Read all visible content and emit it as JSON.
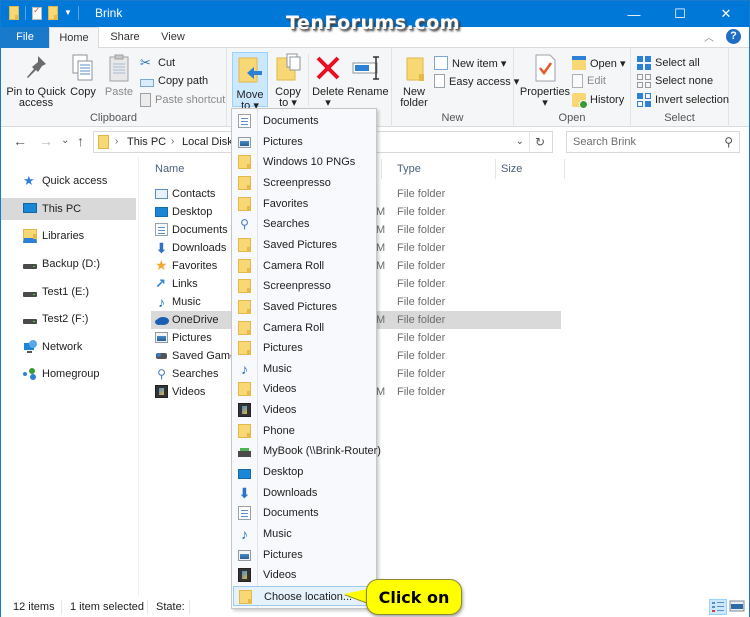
{
  "window": {
    "title": "Brink",
    "watermark": "TenForums.com",
    "controls": {
      "minimize": "—",
      "maximize": "☐",
      "close": "✕"
    }
  },
  "ribbon_tabs": [
    {
      "label": "File"
    },
    {
      "label": "Home"
    },
    {
      "label": "Share"
    },
    {
      "label": "View"
    }
  ],
  "ribbon": {
    "clipboard": {
      "label": "Clipboard",
      "pin": "Pin to Quick access",
      "pin_line1": "Pin to Quick",
      "pin_line2": "access",
      "copy": "Copy",
      "paste": "Paste",
      "cut": "Cut",
      "copy_path": "Copy path",
      "paste_shortcut": "Paste shortcut"
    },
    "organize": {
      "move_line1": "Move",
      "move_line2": "to ▾",
      "copy_line1": "Copy",
      "copy_line2": "to ▾",
      "delete": "Delete",
      "delete_arrow": "▾",
      "rename": "Rename"
    },
    "new": {
      "label": "New",
      "new_folder_line1": "New",
      "new_folder_line2": "folder",
      "new_item": "New item ▾",
      "easy_access": "Easy access ▾"
    },
    "open": {
      "label": "Open",
      "properties": "Properties",
      "properties_arrow": "▾",
      "open": "Open ▾",
      "edit": "Edit",
      "history": "History"
    },
    "select": {
      "label": "Select",
      "select_all": "Select all",
      "select_none": "Select none",
      "invert": "Invert selection"
    }
  },
  "navigation": {
    "back": "←",
    "forward": "→",
    "recent": "⌄",
    "up": "↑",
    "breadcrumb": [
      "This PC",
      "Local Disk (C:)"
    ],
    "breadcrumb_visible": [
      "This PC",
      "Local Disk ("
    ],
    "search_placeholder": "Search Brink"
  },
  "nav_pane": [
    {
      "label": "Quick access",
      "icon": "star-icon"
    },
    {
      "label": "This PC",
      "icon": "computer-icon",
      "selected": true
    },
    {
      "label": "Libraries",
      "icon": "libraries-icon"
    },
    {
      "label": "Backup (D:)",
      "icon": "drive-icon"
    },
    {
      "label": "Test1 (E:)",
      "icon": "drive-icon"
    },
    {
      "label": "Test2 (F:)",
      "icon": "drive-icon"
    },
    {
      "label": "Network",
      "icon": "network-icon"
    },
    {
      "label": "Homegroup",
      "icon": "homegroup-icon"
    }
  ],
  "columns": {
    "name": "Name",
    "type": "Type",
    "size": "Size"
  },
  "files": [
    {
      "name": "Contacts",
      "date_frag": "",
      "type": "File folder",
      "icon": "contacts-icon"
    },
    {
      "name": "Desktop",
      "date_frag": "M",
      "type": "File folder",
      "icon": "desktop-icon"
    },
    {
      "name": "Documents",
      "date_frag": "M",
      "type": "File folder",
      "icon": "documents-icon"
    },
    {
      "name": "Downloads",
      "date_frag": "M",
      "type": "File folder",
      "icon": "downloads-icon"
    },
    {
      "name": "Favorites",
      "date_frag": "M",
      "type": "File folder",
      "icon": "favorites-icon"
    },
    {
      "name": "Links",
      "date_frag": "",
      "type": "File folder",
      "icon": "links-icon"
    },
    {
      "name": "Music",
      "date_frag": "",
      "type": "File folder",
      "icon": "music-icon"
    },
    {
      "name": "OneDrive",
      "date_frag": "M",
      "type": "File folder",
      "icon": "onedrive-icon",
      "selected": true
    },
    {
      "name": "Pictures",
      "date_frag": "",
      "type": "File folder",
      "icon": "pictures-icon"
    },
    {
      "name": "Saved Games",
      "date_frag": "",
      "type": "File folder",
      "icon": "saved-games-icon"
    },
    {
      "name": "Searches",
      "date_frag": "",
      "type": "File folder",
      "icon": "searches-icon"
    },
    {
      "name": "Videos",
      "date_frag": "M",
      "type": "File folder",
      "icon": "videos-icon"
    }
  ],
  "move_menu": [
    {
      "label": "Documents",
      "icon": "doc"
    },
    {
      "label": "Pictures",
      "icon": "pic"
    },
    {
      "label": "Windows 10 PNGs",
      "icon": "folder"
    },
    {
      "label": "Screenpresso",
      "icon": "folder"
    },
    {
      "label": "Favorites",
      "icon": "folder"
    },
    {
      "label": "Searches",
      "icon": "search"
    },
    {
      "label": "Saved Pictures",
      "icon": "folder"
    },
    {
      "label": "Camera Roll",
      "icon": "folder"
    },
    {
      "label": "Screenpresso",
      "icon": "folder"
    },
    {
      "label": "Saved Pictures",
      "icon": "folder"
    },
    {
      "label": "Camera Roll",
      "icon": "folder"
    },
    {
      "label": "Pictures",
      "icon": "folder"
    },
    {
      "label": "Music",
      "icon": "music"
    },
    {
      "label": "Videos",
      "icon": "folder"
    },
    {
      "label": "Videos",
      "icon": "vid"
    },
    {
      "label": "Phone",
      "icon": "folder"
    },
    {
      "label": "MyBook (\\\\Brink-Router)",
      "icon": "netdrive"
    },
    {
      "label": "Desktop",
      "icon": "desktop"
    },
    {
      "label": "Downloads",
      "icon": "down"
    },
    {
      "label": "Documents",
      "icon": "doc"
    },
    {
      "label": "Music",
      "icon": "music"
    },
    {
      "label": "Pictures",
      "icon": "pic"
    },
    {
      "label": "Videos",
      "icon": "vid"
    },
    {
      "label": "Choose location...",
      "icon": "folder",
      "highlighted": true
    }
  ],
  "callout": {
    "text": "Click on"
  },
  "status": {
    "items": "12 items",
    "selected": "1 item selected",
    "state": "State:"
  }
}
